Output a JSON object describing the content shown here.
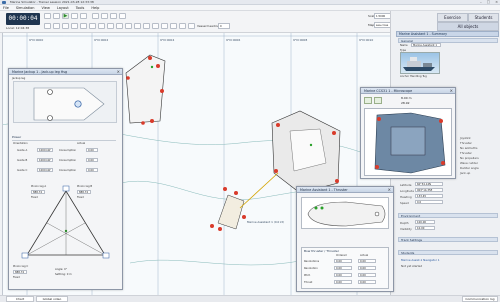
{
  "window": {
    "title": "Marine Simulator - Trainer session 2021-03-28 12:33:38"
  },
  "menu": [
    "File",
    "Simulation",
    "View",
    "Layout",
    "Tools",
    "Help"
  ],
  "toolbar": {
    "clock": "00:00:04",
    "local_time": "Local: 12:04:38",
    "vessel_heading_label": "Vessel heading:",
    "vessel_heading_value": "0",
    "scale_label": "Scale:",
    "scale_value": "1:5000",
    "map_label": "Map:",
    "map_value": "sea-cross"
  },
  "right_tabs": {
    "exercise": "Exercise",
    "students": "Students",
    "all_objects": "All objects"
  },
  "summary_panel": {
    "title": "Marine Assistant 1 - Summary",
    "general": "General",
    "name_label": "Name",
    "name_value": "Marine Assistant 1",
    "type_label": "Type",
    "vessel_caption": "Anchor Handling Tug",
    "rows_right": [
      "Joystick",
      "Thruster",
      "No azimuths",
      "Thruster",
      "No propellers",
      "Wave rudder",
      "Rudder angle",
      "Jack-up"
    ],
    "position_rows": [
      {
        "label": "Latitude",
        "value": "60°34.14N"
      },
      {
        "label": "Longitude",
        "value": "003°14.35E"
      },
      {
        "label": "Heading",
        "value": "133.45"
      },
      {
        "label": "Speed",
        "value": "0.0"
      }
    ],
    "environment": "Environment",
    "env_rows": [
      {
        "label": "Depth",
        "value": "100.00"
      },
      {
        "label": "Visibility",
        "value": "10.00"
      }
    ],
    "track_settings": "Track Settings",
    "students_header": "Students",
    "students_rows": [
      "Marine Assist.1 Navigator 1",
      "Not yet started"
    ]
  },
  "map": {
    "grid_labels": [
      "9°N 0000",
      "9°N 0002",
      "9°N 0004",
      "9°N 0006",
      "9°N 0008",
      "9°N 0010"
    ],
    "vessel_label": "Marine Assistant 1 (0.0 kt)"
  },
  "jackup_window": {
    "title": "Marine Jackup 1 - Jack-up leg Hsg",
    "subtitle": "Jackup leg",
    "power": "Power",
    "orientation": "Orientation",
    "actual": "Actual",
    "guides": [
      {
        "label": "Guide A",
        "req": "1000 kW",
        "cons": "0.00"
      },
      {
        "label": "Guide B",
        "req": "1000 kW",
        "cons": "0.00"
      },
      {
        "label": "Guide C",
        "req": "1000 kW",
        "cons": "0.00"
      }
    ],
    "consumption": "Consumption",
    "pinion_a": "Pinion leg A",
    "pinion_b": "Pinion leg B",
    "pinion_c": "Pinion leg C",
    "leg_value": "888.74",
    "fixed": "Fixed",
    "bottom_readout": [
      "Angle: 0°",
      "Settling: 0 m"
    ]
  },
  "microscope": {
    "title": "Marine CCS31 1 - Microscope",
    "lbl1": "8.00 m",
    "lbl2": "28.92"
  },
  "thruster_window": {
    "title": "Marine Assistant 1 - Thruster",
    "section": "Bow thruster / Thruster",
    "cols": [
      "",
      "Ordered",
      "Actual"
    ],
    "rows": [
      {
        "label": "Revolutions",
        "ordered": "0.00",
        "actual": "0.00"
      },
      {
        "label": "Revolution",
        "ordered": "0.00",
        "actual": "0.00"
      },
      {
        "label": "Pitch",
        "ordered": "0.00",
        "actual": "0.00"
      },
      {
        "label": "Thrust",
        "ordered": "0.00",
        "actual": "0.00"
      }
    ]
  },
  "status_tabs": {
    "chart": "Chart",
    "global": "Global video",
    "comms": "Communication log"
  }
}
